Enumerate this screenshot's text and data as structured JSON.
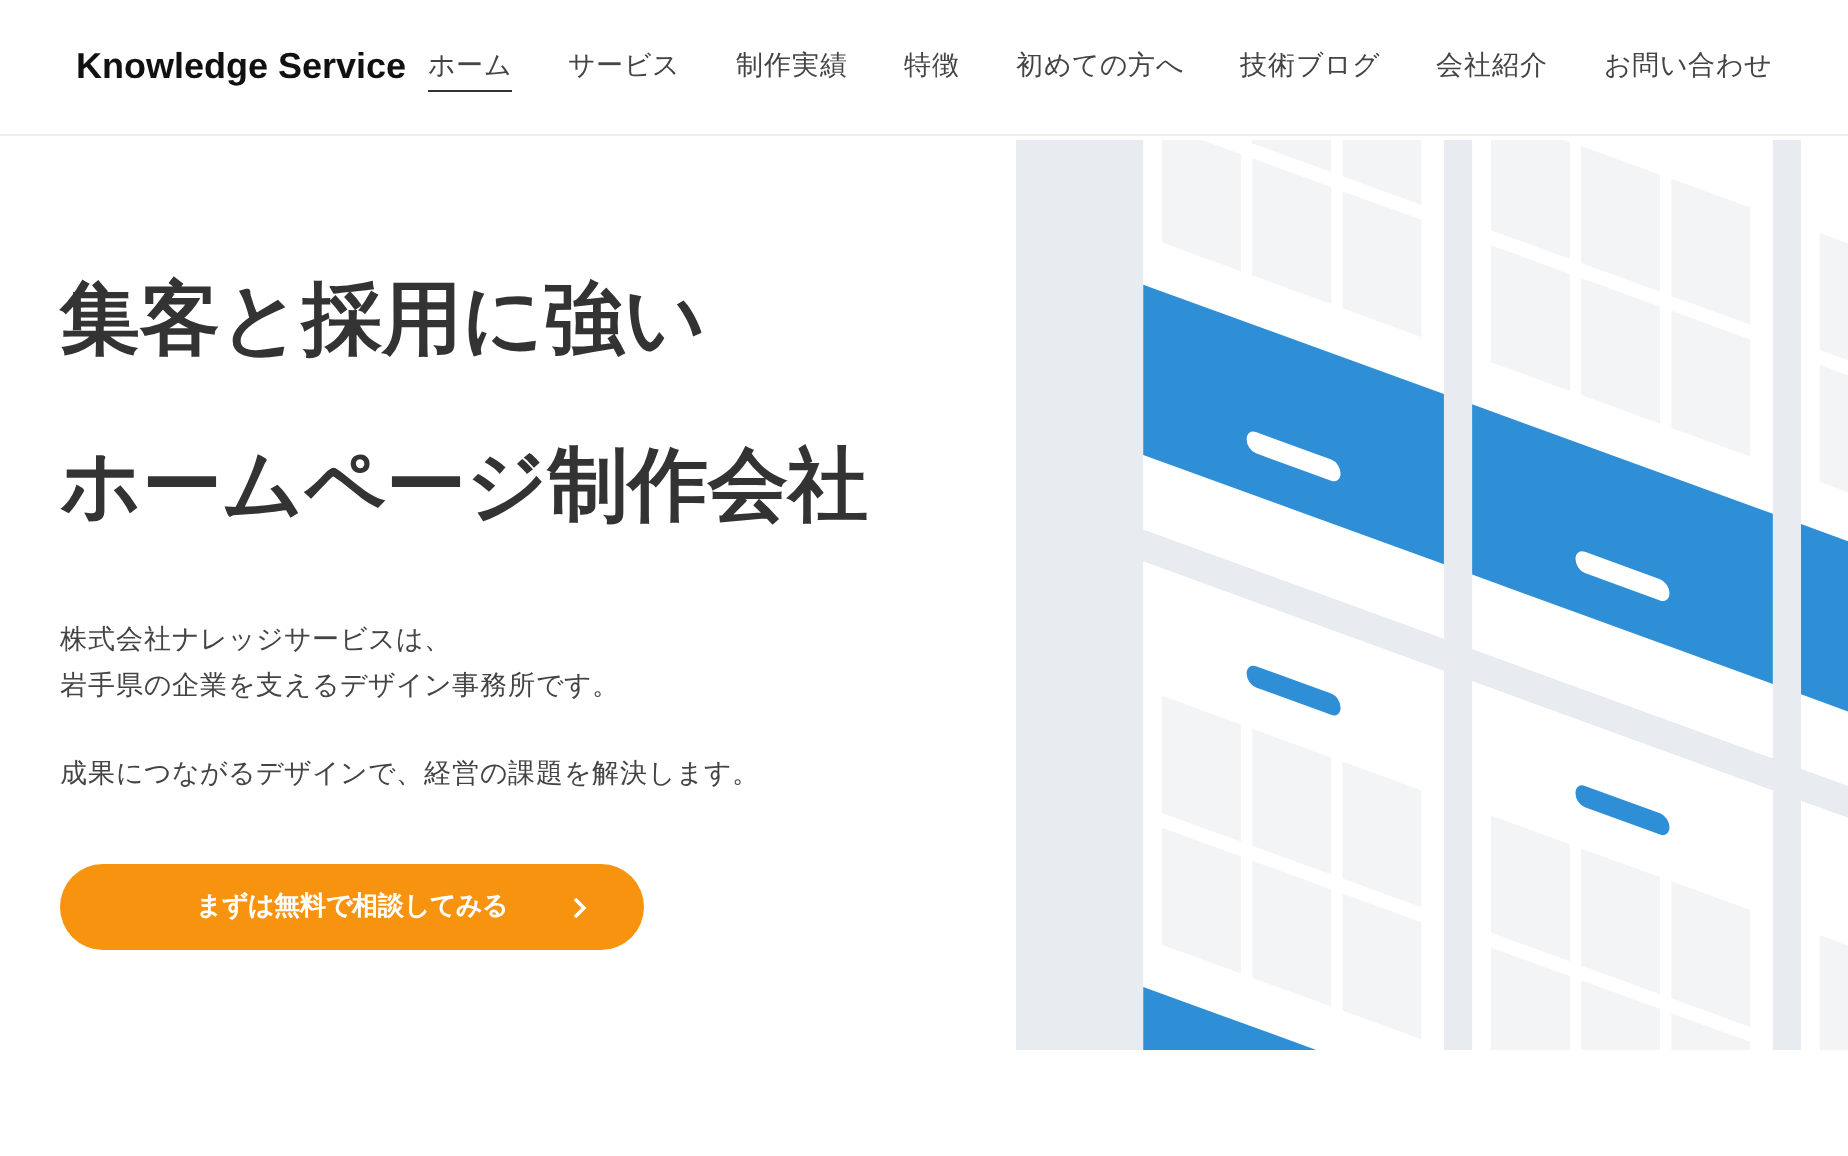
{
  "header": {
    "logo": "Knowledge Service",
    "nav": [
      {
        "label": "ホーム",
        "selected": true
      },
      {
        "label": "サービス",
        "selected": false
      },
      {
        "label": "制作実績",
        "selected": false
      },
      {
        "label": "特徴",
        "selected": false
      },
      {
        "label": "初めての方へ",
        "selected": false
      },
      {
        "label": "技術ブログ",
        "selected": false
      },
      {
        "label": "会社紹介",
        "selected": false
      },
      {
        "label": "お問い合わせ",
        "selected": false
      }
    ]
  },
  "hero": {
    "headline": [
      "集客と採用に強い",
      "ホームページ制作会社"
    ],
    "paragraphs": [
      [
        "株式会社ナレッジサービスは、",
        "岩手県の企業を支えるデザイン事務所です。"
      ],
      [
        "成果につながるデザインで、経営の課題を解決します。"
      ]
    ],
    "cta_button": {
      "label": "まずは無料で相談してみる"
    }
  }
}
